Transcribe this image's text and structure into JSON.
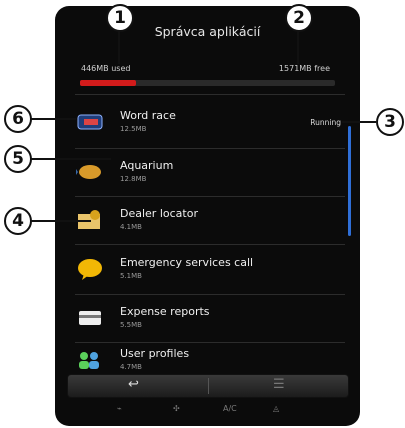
{
  "header": {
    "title": "Správca aplikácií",
    "used": "446MB used",
    "free": "1571MB free",
    "used_fraction": 0.22
  },
  "apps": [
    {
      "name": "Word race",
      "size": "12.5MB",
      "status": "Running",
      "icon": "word-race-icon"
    },
    {
      "name": "Aquarium",
      "size": "12.8MB",
      "status": "",
      "icon": "fish-icon"
    },
    {
      "name": "Dealer locator",
      "size": "4.1MB",
      "status": "",
      "icon": "map-pin-icon"
    },
    {
      "name": "Emergency services call",
      "size": "5.1MB",
      "status": "",
      "icon": "chat-bubble-icon"
    },
    {
      "name": "Expense reports",
      "size": "5.5MB",
      "status": "",
      "icon": "card-icon"
    },
    {
      "name": "User profiles",
      "size": "4.7MB",
      "status": "",
      "icon": "users-icon"
    }
  ],
  "footer": {
    "back": "↩",
    "menu": "☰"
  },
  "controls": [
    "A/C"
  ],
  "callouts": [
    "1",
    "2",
    "3",
    "4",
    "5",
    "6"
  ],
  "colors": {
    "bar": "#d21b1b",
    "scroll": "#2f6fd8"
  }
}
